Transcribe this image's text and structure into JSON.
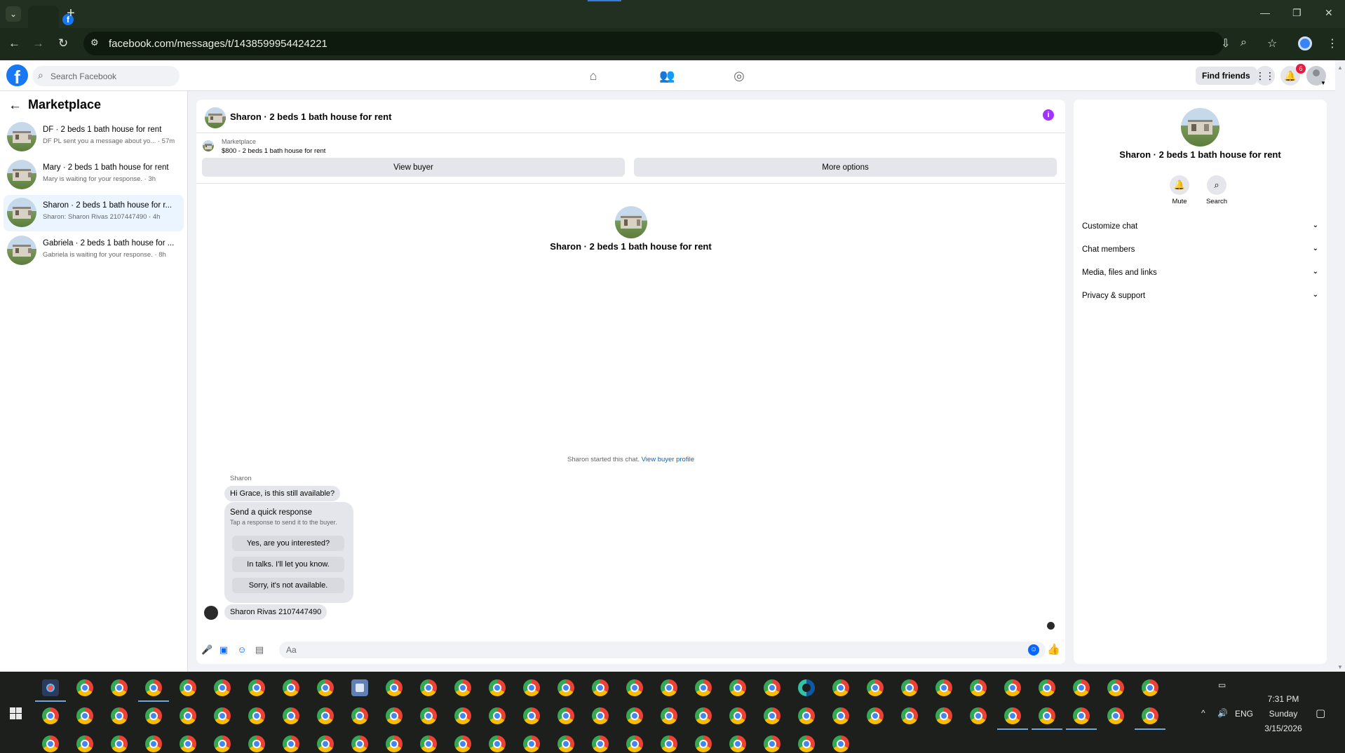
{
  "browser": {
    "url": "facebook.com/messages/t/1438599954424221"
  },
  "topnav": {
    "logo": "f",
    "search_placeholder": "Search Facebook",
    "find_friends": "Find friends",
    "notification_count": "6"
  },
  "left": {
    "title": "Marketplace",
    "conversations": [
      {
        "title": "DF · 2 beds 1 bath house for rent",
        "snippet": "DF PL sent you a message about yo... · 57m",
        "active": false
      },
      {
        "title": "Mary · 2 beds 1 bath house for rent",
        "snippet": "Mary is waiting for your response. · 3h",
        "active": false
      },
      {
        "title": "Sharon · 2 beds 1 bath house for r...",
        "snippet": "Sharon: Sharon Rivas 2107447490 · 4h",
        "active": true
      },
      {
        "title": "Gabriela · 2 beds 1 bath house for ...",
        "snippet": "Gabriela is waiting for your response. · 8h",
        "active": false
      }
    ]
  },
  "chat": {
    "header_title": "Sharon · 2 beds 1 bath house for rent",
    "info_icon": "i",
    "marketplace_label": "Marketplace",
    "listing_price": "$800 - 2 beds 1 bath house for rent",
    "view_buyer": "View buyer",
    "more_options": "More options",
    "center_title": "Sharon · 2 beds 1 bath house for rent",
    "started_text": "Sharon started this chat.",
    "view_buyer_profile": "View buyer profile",
    "sender_name": "Sharon",
    "first_message": "Hi Grace, is this still available?",
    "quick_response_title": "Send a quick response",
    "quick_response_sub": "Tap a response to send it to the buyer.",
    "quick_responses": [
      "Yes, are you interested?",
      "In talks. I'll let you know.",
      "Sorry, it's not available."
    ],
    "second_message": "Sharon Rivas 2107447490",
    "composer_placeholder": "Aa"
  },
  "right": {
    "title": "Sharon · 2 beds 1 bath house for rent",
    "mute_label": "Mute",
    "search_label": "Search",
    "sections": [
      "Customize chat",
      "Chat members",
      "Media, files and links",
      "Privacy & support"
    ]
  },
  "taskbar": {
    "language": "ENG",
    "time": "7:31 PM",
    "day": "Sunday",
    "date": "3/15/2026"
  },
  "colors": {
    "brand_blue": "#1877f2",
    "messenger_blue": "#0866ff",
    "active_row": "#ebf5ff",
    "info_purple": "#a033ff",
    "notification_red": "#e41e3f"
  }
}
